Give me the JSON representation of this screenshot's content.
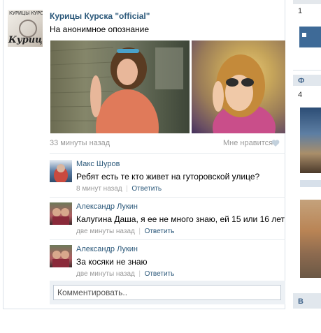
{
  "post": {
    "author": "Курицы Курска \"official\"",
    "text": "На анонимное опознание",
    "time": "33 минуты назад",
    "like_label": "Мне нравится",
    "group_avatar_text_top": "КУРИЦЫ КУРСКА",
    "group_avatar_text_bottom": "Курицы"
  },
  "comments": [
    {
      "name": "Макс Шуров",
      "text": "Ребят есть те кто живет на гуторовской улице?",
      "time": "8 минут назад",
      "reply": "Ответить"
    },
    {
      "name": "Александр Лукин",
      "text": "Калугина Даша, я ее не много знаю, ей 15 или 16 лет",
      "time": "две минуты назад",
      "reply": "Ответить"
    },
    {
      "name": "Александр Лукин",
      "text": "За косяки не знаю",
      "time": "две минуты назад",
      "reply": "Ответить"
    }
  ],
  "comment_input": {
    "placeholder": "Комментировать.."
  },
  "sidebar": {
    "frag1": "1",
    "frag2": "Ф",
    "frag3": "4",
    "frag4": "В"
  },
  "colors": {
    "link": "#2b587a",
    "meta": "#999999",
    "border": "#dae1e8",
    "accent": "#597da3"
  }
}
